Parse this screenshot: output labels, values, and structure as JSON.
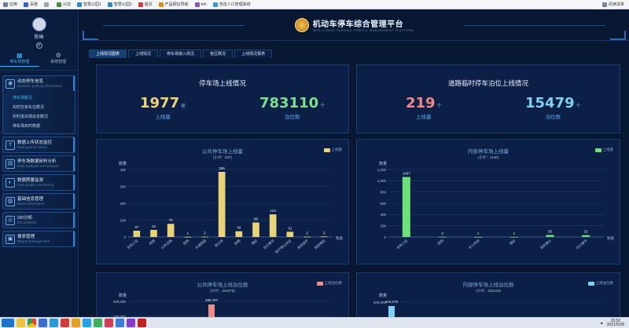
{
  "bookmarks": {
    "items": [
      {
        "label": "应用",
        "icon": "apps-grid-icon",
        "color": "#6a7fa0"
      },
      {
        "label": "百度",
        "icon": "baidu-icon",
        "color": "#2f62e0"
      },
      {
        "label": "",
        "icon": "blank-bookmark-icon",
        "color": "#9aa6b8"
      },
      {
        "label": "兴迈",
        "icon": "bookmark-icon",
        "color": "#3f8f3f"
      },
      {
        "label": "智慧公园1",
        "icon": "bookmark-icon",
        "color": "#2a8ad0"
      },
      {
        "label": "智慧公园2",
        "icon": "bookmark-icon",
        "color": "#2a8ad0"
      },
      {
        "label": "首页",
        "icon": "bookmark-icon",
        "color": "#d04040"
      },
      {
        "label": "产品网址导航",
        "icon": "bookmark-icon",
        "color": "#e08a20"
      },
      {
        "label": "teh",
        "icon": "bookmark-icon",
        "color": "#8a55c0"
      },
      {
        "label": "洗洁人口管理系统",
        "icon": "bookmark-icon",
        "color": "#3a9ad8"
      }
    ],
    "reading_list": "阅读清单"
  },
  "sidebar": {
    "username": "陈琳",
    "top_tabs": [
      {
        "label": "停车场管理",
        "icon": "parking-grid-icon"
      },
      {
        "label": "系统管理",
        "icon": "gear-icon"
      }
    ],
    "groups": [
      {
        "title": "动态停车信息",
        "subtitle": "Dynamic parking information",
        "icon": "chart-icon",
        "items": [
          "停车场概况",
          "实时空余车位概况",
          "实时进出场信息概况",
          "停车场实时数据"
        ]
      },
      {
        "title": "数据上传状态监控",
        "subtitle": "Data upload status",
        "icon": "upload-icon",
        "items": []
      },
      {
        "title": "停车场数据研判分析",
        "subtitle": "Data analysis and analysis",
        "icon": "analysis-icon",
        "items": []
      },
      {
        "title": "数据质量监测",
        "subtitle": "Data quality monitoring",
        "icon": "quality-icon",
        "items": []
      },
      {
        "title": "基础信息管理",
        "subtitle": "Basic information",
        "icon": "info-icon",
        "items": []
      },
      {
        "title": "OD分析",
        "subtitle": "OD analysis",
        "icon": "od-icon",
        "items": []
      },
      {
        "title": "报表管理",
        "subtitle": "Report management",
        "icon": "report-icon",
        "items": []
      }
    ]
  },
  "header": {
    "title": "机动车停车综合管理平台",
    "subtitle": "INTELLIGENT PARKING TRAFFIC MANAGEMENT PLATFORM"
  },
  "tabs": [
    "上线情况图表",
    "上线情况",
    "停车场接入情况",
    "各区概况",
    "上线情况报表"
  ],
  "stats": {
    "left": {
      "title": "停车场上线情况",
      "items": [
        {
          "value": "1977",
          "unit": "家",
          "label": "上线量",
          "color": "#f2d37a"
        },
        {
          "value": "783110",
          "unit": "个",
          "label": "泊位数",
          "color": "#7de08a"
        }
      ]
    },
    "right": {
      "title": "道路临时停车泊位上线情况",
      "items": [
        {
          "value": "219",
          "unit": "个",
          "label": "上线量",
          "color": "#f08a8a"
        },
        {
          "value": "15479",
          "unit": "个",
          "label": "泊位数",
          "color": "#7fd0f0"
        }
      ]
    }
  },
  "chart_data": [
    {
      "type": "bar",
      "title": "公共停车场上线量",
      "subtitle": "(小计：837)",
      "legend": "上线量",
      "color": "#e8d27a",
      "ylabel": "数量",
      "xlabel": "性质",
      "ylim": [
        0,
        400
      ],
      "yticks": [
        0,
        100,
        200,
        300,
        400
      ],
      "categories": [
        "住宅小区",
        "宾馆",
        "公共设施",
        "医院",
        "交通枢纽",
        "商业体",
        "旅馆",
        "酒店",
        "办公楼宇",
        "若干等公共区",
        "商务楼宇",
        "旅游景区"
      ],
      "values": [
        37,
        42,
        78,
        1,
        2,
        386,
        34,
        86,
        134,
        31,
        2,
        3
      ]
    },
    {
      "type": "bar",
      "title": "内部停车场上线量",
      "subtitle": "(小计：1140)",
      "legend": "上线量",
      "color": "#6ee07a",
      "ylabel": "数量",
      "xlabel": "性质",
      "ylim": [
        0,
        1200
      ],
      "yticks": [
        0,
        200,
        400,
        600,
        800,
        1000,
        1200
      ],
      "categories": [
        "住宅小区",
        "医院",
        "中小学校",
        "酒店",
        "政府事业",
        "办公楼宇"
      ],
      "values": [
        1067,
        3,
        1,
        1,
        36,
        32
      ]
    },
    {
      "type": "bar",
      "title": "公共停车场上线泊位数",
      "subtitle": "(小计：342976)",
      "legend": "上线泊位数",
      "color": "#f08a8a",
      "ylabel": "数量",
      "yticks_visible": [
        "150,000",
        "200,000"
      ],
      "visible_value": "185,767"
    },
    {
      "type": "bar",
      "title": "内部停车场上线泊位数",
      "subtitle": "(小计：440134)",
      "legend": "上线泊位数",
      "color": "#7fd0f0",
      "ylabel": "数量",
      "yticks_visible": [
        "400,000"
      ],
      "visible_value": "424,176"
    }
  ],
  "taskbar": {
    "time": "15:52",
    "date": "2021/5/28"
  }
}
